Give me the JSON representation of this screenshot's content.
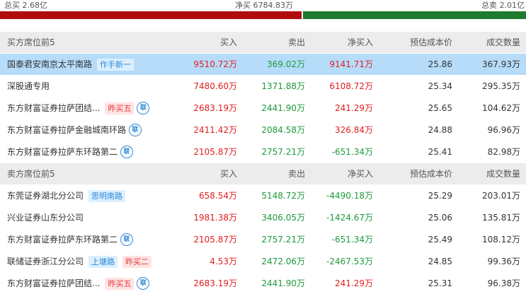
{
  "summary": {
    "total_buy": "总买 2.68亿",
    "net_buy": "净买 6784.83万",
    "total_sell": "总卖 2.01亿"
  },
  "colors": {
    "buy_bar": "#b00c0c",
    "sell_bar": "#1e7a2e",
    "highlight": "#b6dcfa",
    "header_bg": "#ececec",
    "up": "#e01e1e",
    "down": "#1d9a3a"
  },
  "buy_table": {
    "headers": [
      "买方席位前5",
      "买入",
      "卖出",
      "净买入",
      "预估成本价",
      "成交数量"
    ],
    "rows": [
      {
        "name": "国泰君安南京太平南路",
        "tags": [
          {
            "text": "作手新一",
            "style": "blue"
          }
        ],
        "lian_icon": false,
        "buy": "9510.72万",
        "sell": "369.02万",
        "net": "9141.71万",
        "net_sign": "up",
        "cost": "25.86",
        "volume": "367.93万"
      },
      {
        "name": "深股通专用",
        "tags": [],
        "lian_icon": false,
        "buy": "7480.60万",
        "sell": "1371.88万",
        "net": "6108.72万",
        "net_sign": "up",
        "cost": "25.34",
        "volume": "295.35万"
      },
      {
        "name": "东方财富证券拉萨团结...",
        "tags": [
          {
            "text": "昨买五",
            "style": "pink"
          }
        ],
        "lian_icon": true,
        "buy": "2683.19万",
        "sell": "2441.90万",
        "net": "241.29万",
        "net_sign": "up",
        "cost": "25.65",
        "volume": "104.62万"
      },
      {
        "name": "东方财富证券拉萨金融城南环路",
        "tags": [],
        "lian_icon": true,
        "buy": "2411.42万",
        "sell": "2084.58万",
        "net": "326.84万",
        "net_sign": "up",
        "cost": "24.88",
        "volume": "96.96万"
      },
      {
        "name": "东方财富证券拉萨东环路第二",
        "tags": [],
        "lian_icon": true,
        "buy": "2105.87万",
        "sell": "2757.21万",
        "net": "-651.34万",
        "net_sign": "down",
        "cost": "25.41",
        "volume": "82.98万"
      }
    ]
  },
  "sell_table": {
    "headers": [
      "卖方席位前5",
      "买入",
      "卖出",
      "净买入",
      "预估成本价",
      "成交数量"
    ],
    "rows": [
      {
        "name": "东莞证券湖北分公司",
        "tags": [
          {
            "text": "思明南路",
            "style": "blue"
          }
        ],
        "lian_icon": false,
        "buy": "658.54万",
        "sell": "5148.72万",
        "net": "-4490.18万",
        "net_sign": "down",
        "cost": "25.29",
        "volume": "203.01万"
      },
      {
        "name": "兴业证券山东分公司",
        "tags": [],
        "lian_icon": false,
        "buy": "1981.38万",
        "sell": "3406.05万",
        "net": "-1424.67万",
        "net_sign": "down",
        "cost": "25.06",
        "volume": "135.81万"
      },
      {
        "name": "东方财富证券拉萨东环路第二",
        "tags": [],
        "lian_icon": true,
        "buy": "2105.87万",
        "sell": "2757.21万",
        "net": "-651.34万",
        "net_sign": "down",
        "cost": "25.49",
        "volume": "108.12万"
      },
      {
        "name": "联储证券浙江分公司",
        "tags": [
          {
            "text": "上塘路",
            "style": "blue"
          },
          {
            "text": "昨买二",
            "style": "pink"
          }
        ],
        "lian_icon": false,
        "buy": "4.53万",
        "sell": "2472.06万",
        "net": "-2467.53万",
        "net_sign": "down",
        "cost": "24.85",
        "volume": "99.36万"
      },
      {
        "name": "东方财富证券拉萨团结...",
        "tags": [
          {
            "text": "昨买五",
            "style": "pink"
          }
        ],
        "lian_icon": true,
        "buy": "2683.19万",
        "sell": "2441.90万",
        "net": "241.29万",
        "net_sign": "up",
        "cost": "25.31",
        "volume": "96.38万"
      }
    ]
  },
  "lian_label": "联"
}
